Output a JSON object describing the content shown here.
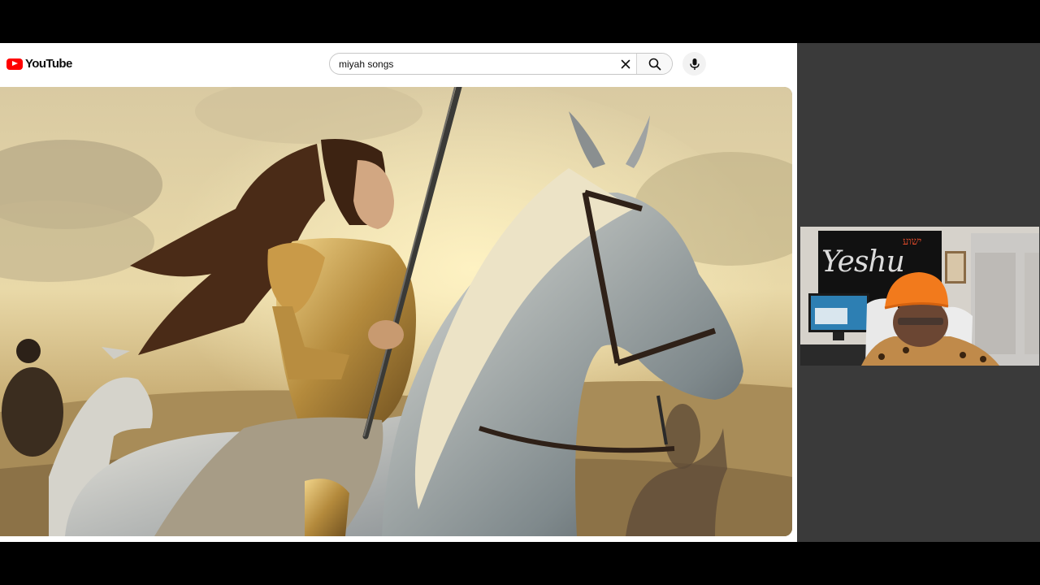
{
  "app": {
    "logo_text": "YouTube",
    "brand_color": "#ff0000"
  },
  "search": {
    "value": "miyah songs",
    "placeholder": "Search"
  },
  "icons": {
    "logo": "youtube-logo-icon",
    "clear": "close-icon",
    "search": "search-icon",
    "mic": "microphone-icon"
  },
  "webcam": {
    "banner_text": "Yeshu",
    "hebrew_text": "ישוע"
  }
}
